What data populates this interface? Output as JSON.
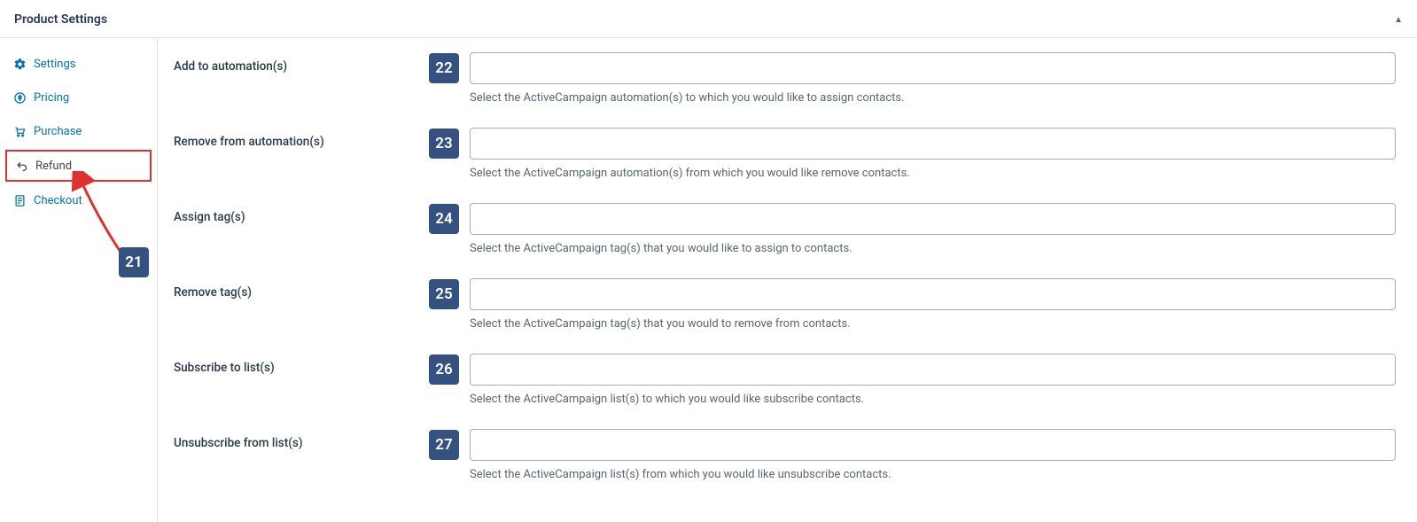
{
  "header": {
    "title": "Product Settings"
  },
  "sidebar": {
    "items": [
      {
        "label": "Settings",
        "icon": "gear-icon"
      },
      {
        "label": "Pricing",
        "icon": "dollar-icon"
      },
      {
        "label": "Purchase",
        "icon": "cart-icon"
      },
      {
        "label": "Refund",
        "icon": "return-icon",
        "active": true
      },
      {
        "label": "Checkout",
        "icon": "page-icon"
      }
    ]
  },
  "callouts": {
    "sidebar_badge": "21",
    "field_badges": [
      "22",
      "23",
      "24",
      "25",
      "26",
      "27"
    ]
  },
  "fields": [
    {
      "label": "Add to automation(s)",
      "help": "Select the ActiveCampaign automation(s) to which you would like to assign contacts."
    },
    {
      "label": "Remove from automation(s)",
      "help": "Select the ActiveCampaign automation(s) from which you would like remove contacts."
    },
    {
      "label": "Assign tag(s)",
      "help": "Select the ActiveCampaign tag(s) that you would like to assign to contacts."
    },
    {
      "label": "Remove tag(s)",
      "help": "Select the ActiveCampaign tag(s) that you would to remove from contacts."
    },
    {
      "label": "Subscribe to list(s)",
      "help": "Select the ActiveCampaign list(s) to which you would like subscribe contacts."
    },
    {
      "label": "Unsubscribe from list(s)",
      "help": "Select the ActiveCampaign list(s) from which you would like unsubscribe contacts."
    }
  ]
}
